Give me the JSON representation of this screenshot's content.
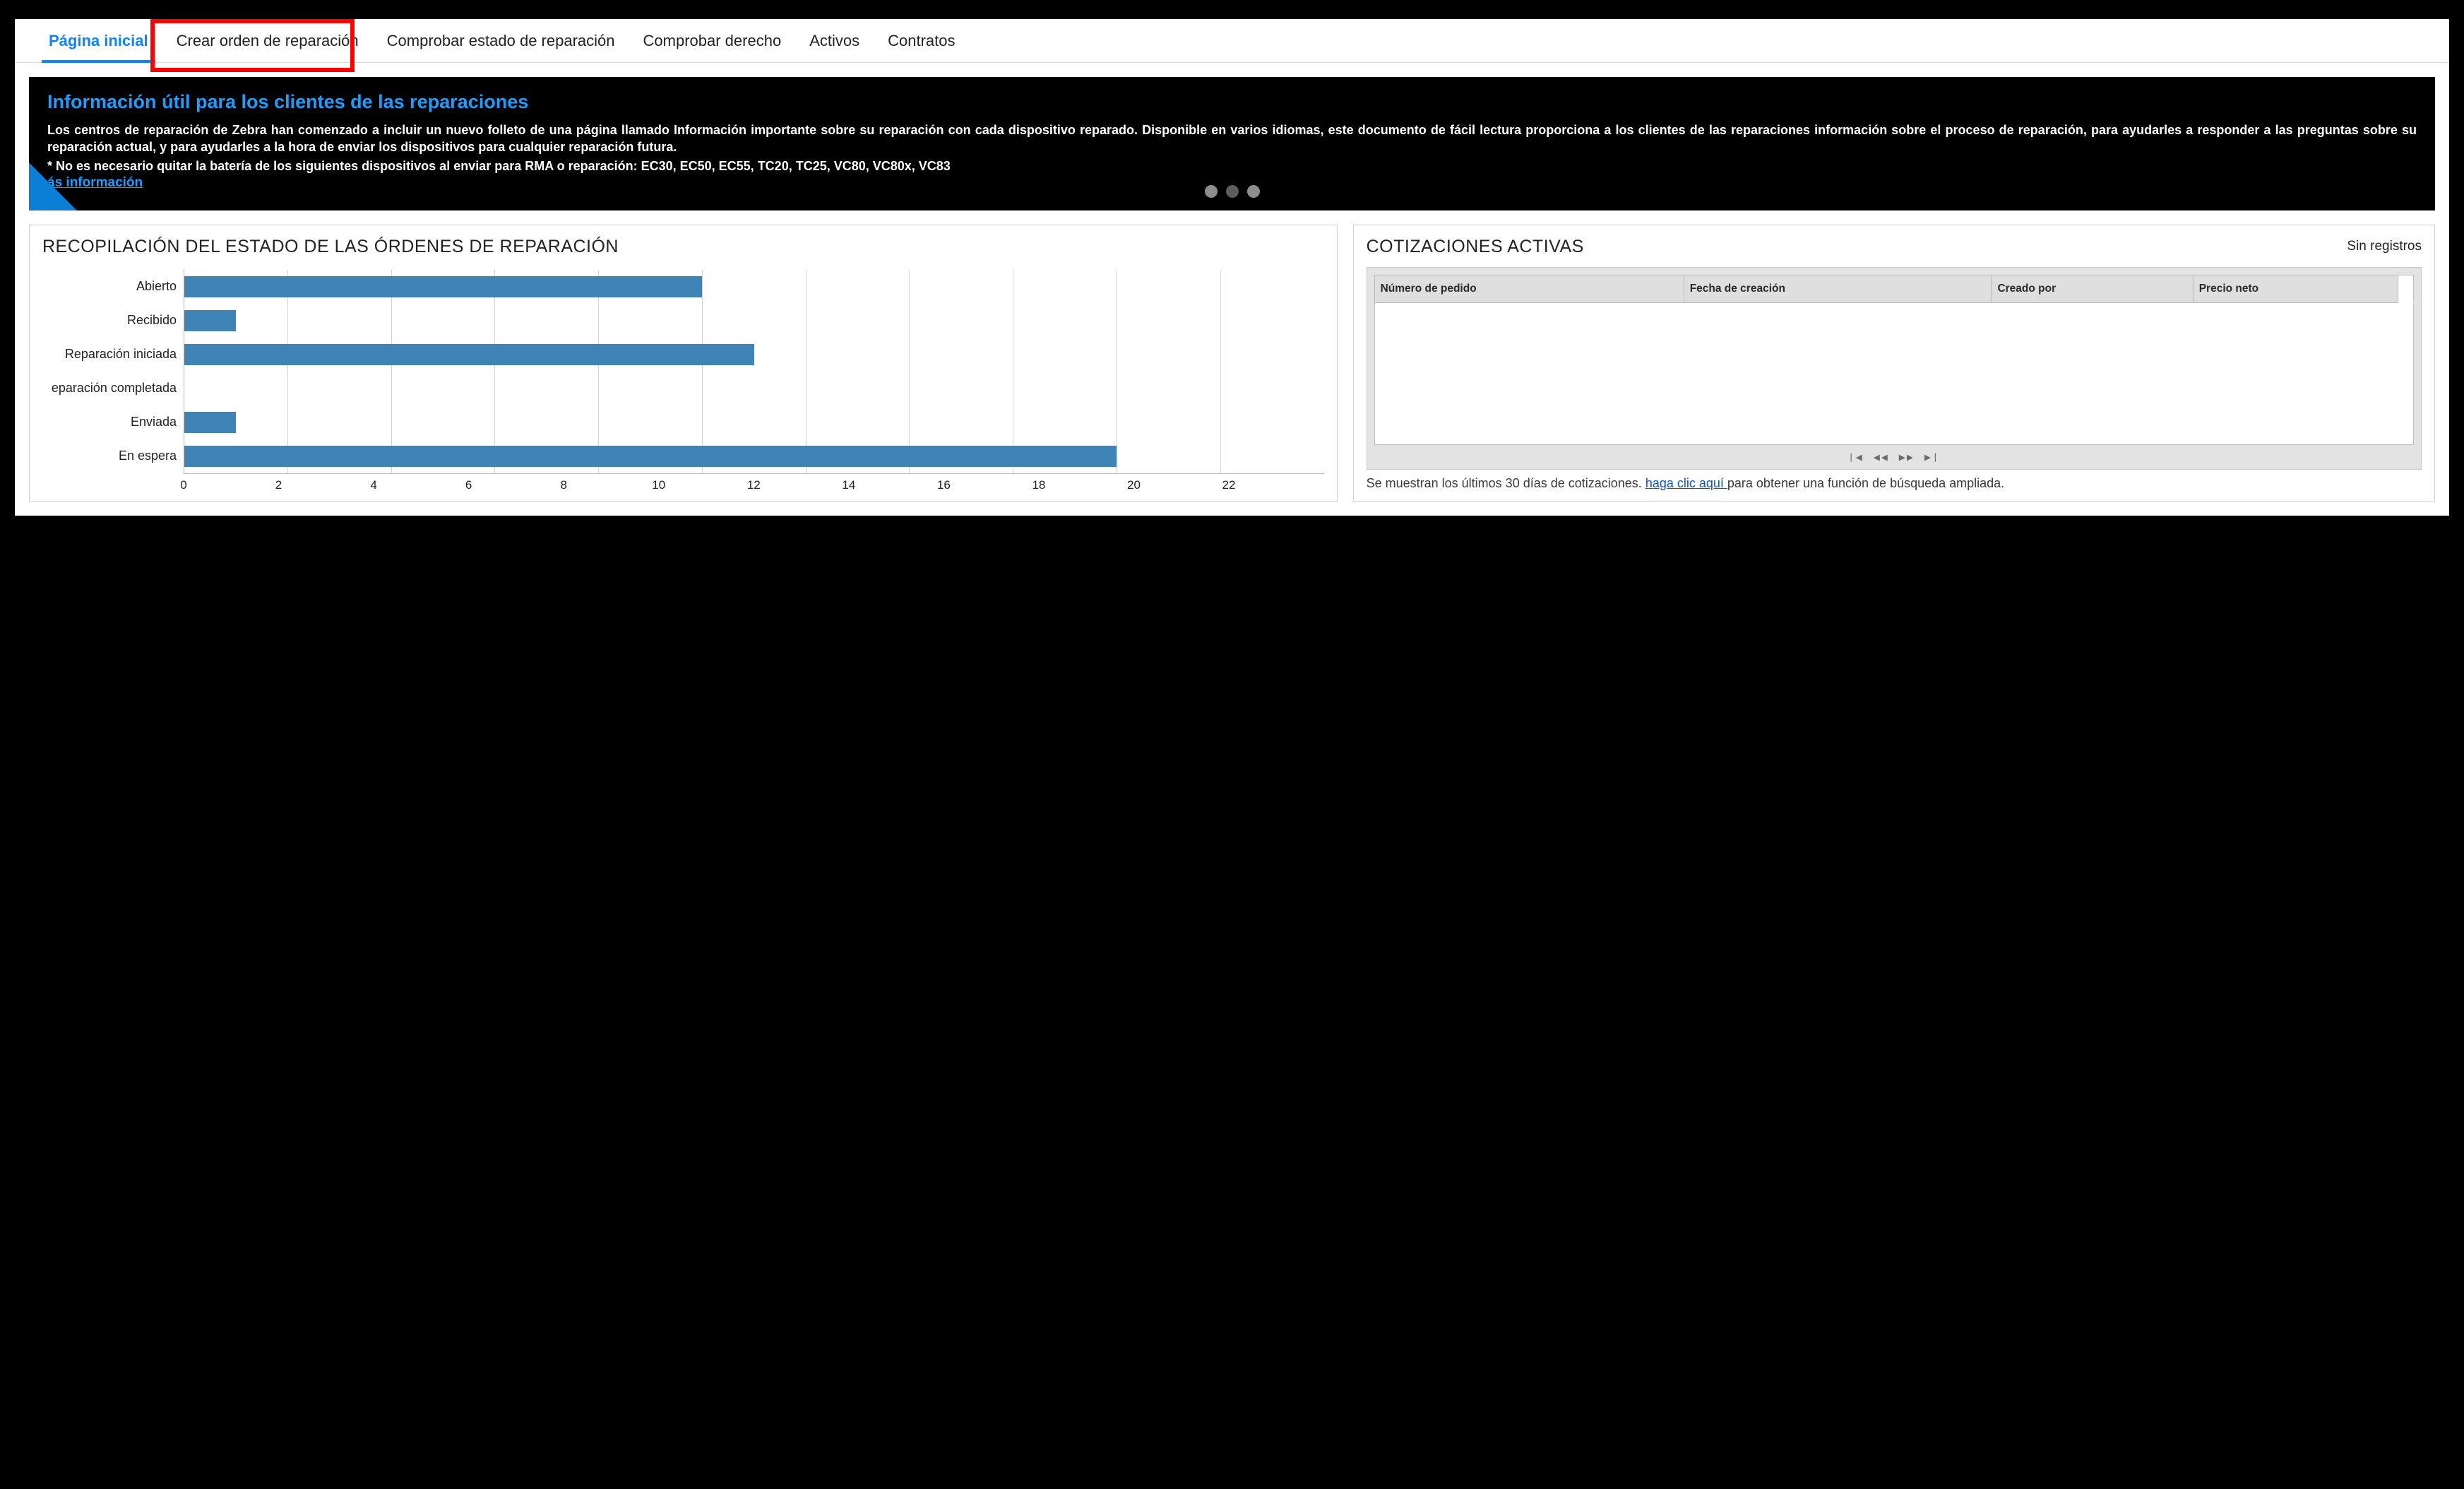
{
  "tabs": [
    {
      "label": "Página inicial",
      "active": true
    },
    {
      "label": "Crear orden de reparación",
      "active": false
    },
    {
      "label": "Comprobar estado de reparación",
      "active": false
    },
    {
      "label": "Comprobar derecho",
      "active": false
    },
    {
      "label": "Activos",
      "active": false
    },
    {
      "label": "Contratos",
      "active": false
    }
  ],
  "highlight_tab_index": 1,
  "banner": {
    "title": "Información útil para los clientes de las reparaciones",
    "body": "Los centros de reparación de Zebra han comenzado a incluir un nuevo folleto de una página llamado Información importante sobre su reparación con cada dispositivo reparado. Disponible en varios idiomas, este documento de fácil lectura proporciona a los clientes de las reparaciones información sobre el proceso de reparación, para ayudarles a responder a las preguntas sobre su reparación actual, y para ayudarles a la hora de enviar los dispositivos para cualquier reparación futura.",
    "note": "* No es necesario quitar la batería de los siguientes dispositivos al enviar para RMA o reparación: EC30, EC50, EC55, TC20, TC25, VC80, VC80x, VC83",
    "link_label": "ás información",
    "dot_count": 3,
    "active_dot": 1
  },
  "left_panel": {
    "title": "RECOPILACIÓN DEL ESTADO DE LAS ÓRDENES DE REPARACIÓN"
  },
  "chart_data": {
    "type": "bar",
    "orientation": "horizontal",
    "categories": [
      "Abierto",
      "Recibido",
      "Reparación iniciada",
      "eparación completada",
      "Enviada",
      "En espera"
    ],
    "values": [
      10,
      1,
      11,
      0,
      1,
      18
    ],
    "xlabel": "",
    "ylabel": "",
    "xlim": [
      0,
      22
    ],
    "xticks": [
      0,
      2,
      4,
      6,
      8,
      10,
      12,
      14,
      16,
      18,
      20,
      22
    ],
    "bar_color": "#3f84b7"
  },
  "right_panel": {
    "title": "COTIZACIONES ACTIVAS",
    "empty_label": "Sin registros",
    "columns": [
      "Número de pedido",
      "Fecha de creación",
      "Creado por",
      "Precio neto"
    ],
    "rows": [],
    "caption_prefix": "Se muestran los últimos 30 días de cotizaciones. ",
    "caption_link": " haga clic aquí ",
    "caption_suffix": "para obtener una función de búsqueda ampliada.",
    "pager_glyphs": {
      "first": "❘◀",
      "prev": "◀◀",
      "next": "▶▶",
      "last": "▶❘"
    }
  }
}
